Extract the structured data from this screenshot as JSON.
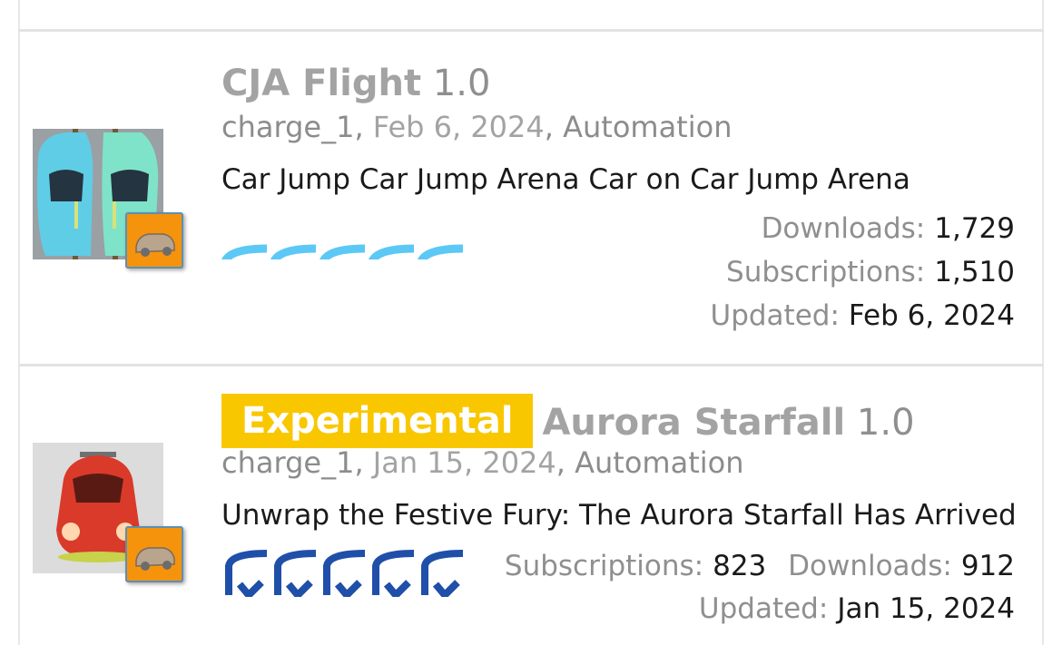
{
  "items": [
    {
      "name": "CJA Flight",
      "version": "1.0",
      "tag": "",
      "author": "charge_1",
      "date": "Feb 6, 2024",
      "category": "Automation",
      "description": "Car Jump Car Jump Arena Car on Car Jump Arena",
      "stats": [
        {
          "label": "Downloads:",
          "value": "1,729"
        },
        {
          "label": "Subscriptions:",
          "value": "1,510"
        },
        {
          "label": "Updated:",
          "value": "Feb 6, 2024"
        }
      ],
      "rating_color": "#5cc8f5"
    },
    {
      "name": "Aurora Starfall",
      "version": "1.0",
      "tag": "Experimental",
      "author": "charge_1",
      "date": "Jan 15, 2024",
      "category": "Automation",
      "description": "Unwrap the Festive Fury: The Aurora Starfall Has Arrived",
      "stats": [
        {
          "label": "Subscriptions:",
          "value": "823"
        },
        {
          "label": "Downloads:",
          "value": "912"
        },
        {
          "label": "Updated:",
          "value": "Jan 15, 2024"
        }
      ],
      "rating_color": "#1f4fa8"
    }
  ],
  "colors": {
    "tag_bg": "#f9c700",
    "badge_bg": "#f6930c",
    "badge_border": "#5d8fb4"
  },
  "separators": [
    ",",
    ","
  ]
}
